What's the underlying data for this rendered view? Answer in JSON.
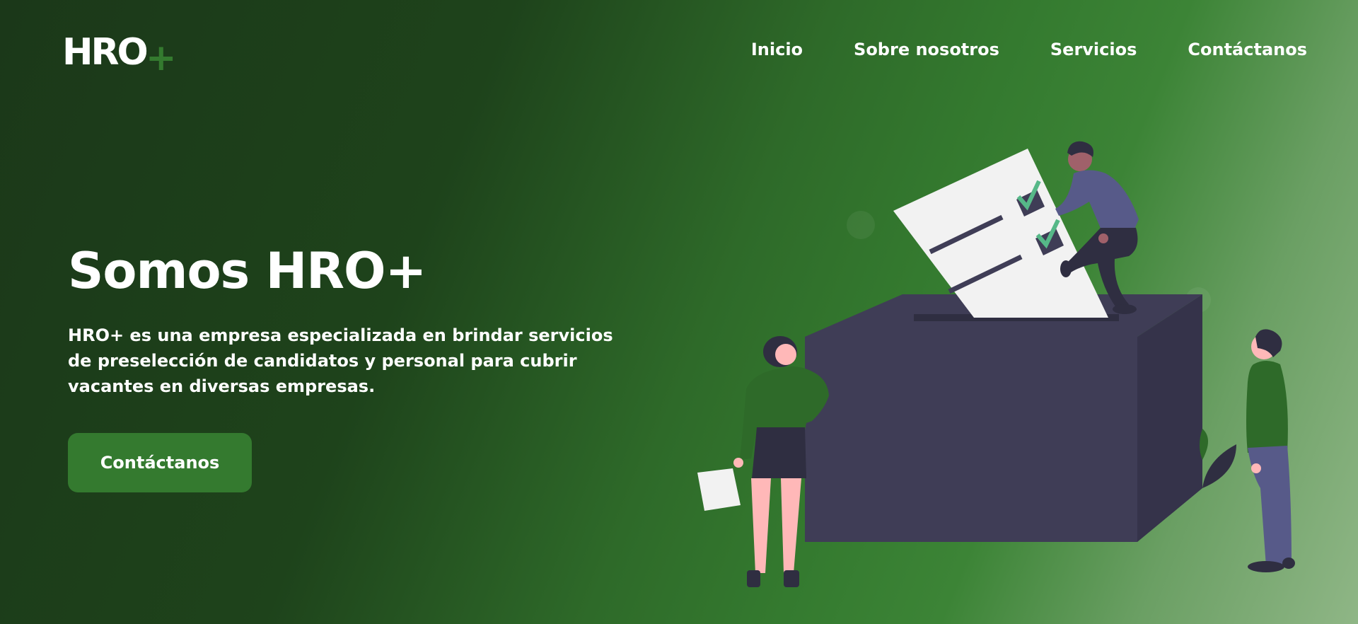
{
  "header": {
    "logo_text": "HRO",
    "logo_plus": "+",
    "nav": [
      "Inicio",
      "Sobre nosotros",
      "Servicios",
      "Contáctanos"
    ]
  },
  "hero": {
    "title": "Somos HRO+",
    "description": "HRO+ es una empresa especializada en brindar servicios de preselección de candidatos y personal para cubrir vacantes en diversas empresas.",
    "cta_label": "Contáctanos"
  },
  "colors": {
    "accent_green": "#347a2f",
    "dark_green": "#1b3819",
    "ballot_box": "#3f3d56",
    "paper": "#f2f2f2",
    "check": "#56b888",
    "skin": "#ffb8b8",
    "shirt_purple": "#575a89"
  },
  "icons": {
    "illustration": "ballot-box-voting-illustration"
  }
}
